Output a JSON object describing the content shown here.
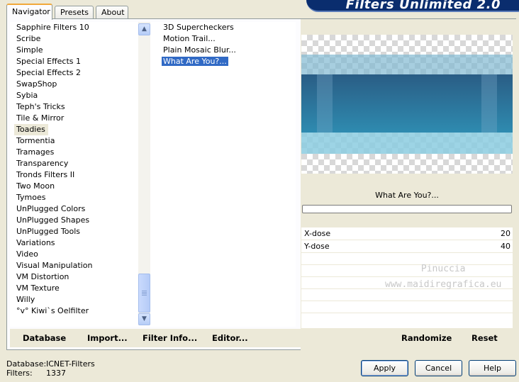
{
  "banner": {
    "title": "Filters Unlimited 2.0"
  },
  "tabs": [
    {
      "label": "Navigator",
      "active": true
    },
    {
      "label": "Presets",
      "active": false
    },
    {
      "label": "About",
      "active": false
    }
  ],
  "categories": [
    "Sapphire Filters 10",
    "Scribe",
    "Simple",
    "Special Effects 1",
    "Special Effects 2",
    "SwapShop",
    "Sybia",
    "Teph's Tricks",
    "Tile & Mirror",
    "Toadies",
    "Tormentia",
    "Tramages",
    "Transparency",
    "Tronds Filters II",
    "Two Moon",
    "Tymoes",
    "UnPlugged Colors",
    "UnPlugged Shapes",
    "UnPlugged Tools",
    "Variations",
    "Video",
    "Visual Manipulation",
    "VM Distortion",
    "VM Texture",
    "Willy",
    "°v° Kiwi`s Oelfilter"
  ],
  "selected_category": "Toadies",
  "filters": [
    "3D Supercheckers",
    "Motion Trail...",
    "Plain Mosaic Blur...",
    "What Are You?..."
  ],
  "selected_filter": "What Are You?...",
  "preview": {
    "filter_name": "What Are You?..."
  },
  "params": [
    {
      "label": "X-dose",
      "value": "20"
    },
    {
      "label": "Y-dose",
      "value": "40"
    }
  ],
  "watermark": {
    "line1": "Pinuccia",
    "line2": "www.maidiregrafica.eu"
  },
  "bottom_links": {
    "database": "Database",
    "import": "Import...",
    "filter_info": "Filter Info...",
    "editor": "Editor...",
    "randomize": "Randomize",
    "reset": "Reset"
  },
  "status": {
    "database_label": "Database:",
    "database_value": "ICNET-Filters",
    "filters_label": "Filters:",
    "filters_value": "1337"
  },
  "buttons": {
    "apply": "Apply",
    "cancel": "Cancel",
    "help": "Help"
  },
  "colors": {
    "selection": "#316ac5",
    "banner": "#0a2d6e",
    "tab_highlight": "#f1a83a"
  }
}
